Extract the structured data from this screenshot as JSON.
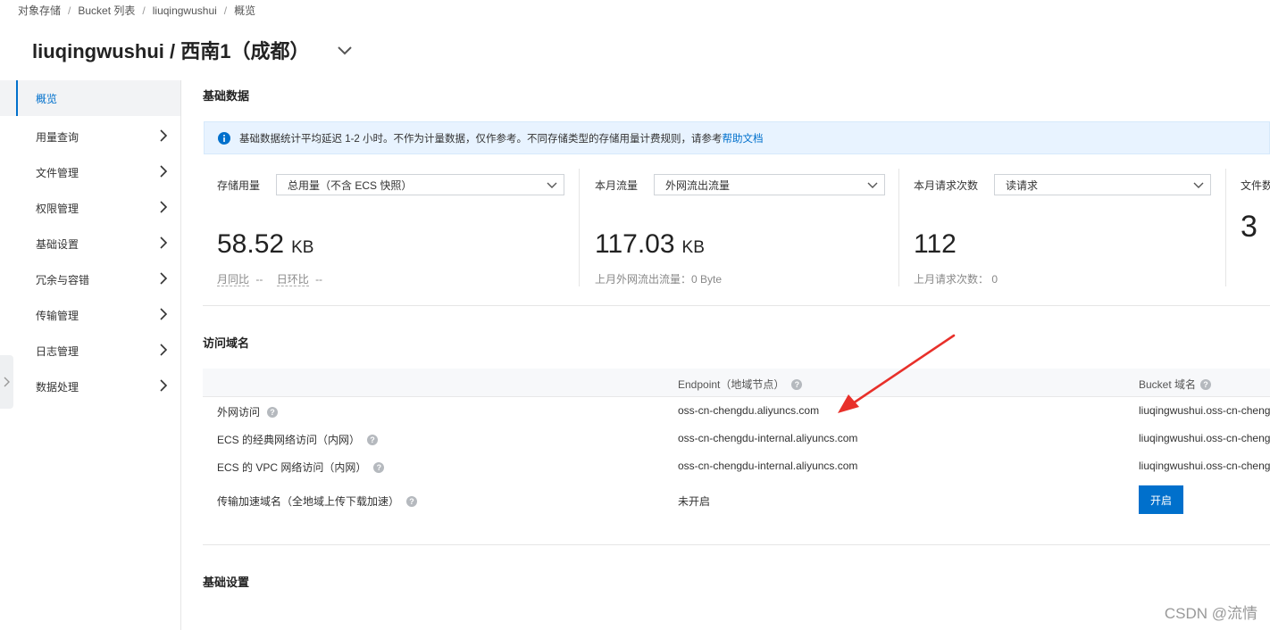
{
  "breadcrumb": [
    "对象存储",
    "Bucket 列表",
    "liuqingwushui",
    "概览"
  ],
  "page_title": "liuqingwushui / 西南1（成都）",
  "sidebar": {
    "items": [
      {
        "label": "概览",
        "active": true
      },
      {
        "label": "用量查询"
      },
      {
        "label": "文件管理"
      },
      {
        "label": "权限管理"
      },
      {
        "label": "基础设置"
      },
      {
        "label": "冗余与容错"
      },
      {
        "label": "传输管理"
      },
      {
        "label": "日志管理"
      },
      {
        "label": "数据处理"
      }
    ]
  },
  "sections": {
    "basic_data": "基础数据",
    "access_domain": "访问域名",
    "basic_settings": "基础设置"
  },
  "notice": {
    "text": "基础数据统计平均延迟 1-2 小时。不作为计量数据，仅作参考。不同存储类型的存储用量计费规则，请参考",
    "link": "帮助文档"
  },
  "stats": [
    {
      "label": "存储用量",
      "select": "总用量（不含 ECS 快照）",
      "value": "58.52",
      "unit": "KB",
      "sub_a_label": "月同比",
      "sub_a_value": "--",
      "sub_b_label": "日环比",
      "sub_b_value": "--"
    },
    {
      "label": "本月流量",
      "select": "外网流出流量",
      "value": "117.03",
      "unit": "KB",
      "sub": "上月外网流出流量：0 Byte"
    },
    {
      "label": "本月请求次数",
      "select": "读请求",
      "value": "112",
      "sub": "上月请求次数：  0"
    },
    {
      "label": "文件数",
      "value": "3"
    }
  ],
  "domain_table": {
    "headers": [
      "Endpoint（地域节点）",
      "Bucket 域名"
    ],
    "rows": [
      {
        "name": "外网访问",
        "endpoint": "oss-cn-chengdu.aliyuncs.com",
        "bucket": "liuqingwushui.oss-cn-chengdu.aliyuncs.com"
      },
      {
        "name": "ECS 的经典网络访问（内网）",
        "endpoint": "oss-cn-chengdu-internal.aliyuncs.com",
        "bucket": "liuqingwushui.oss-cn-chengdu-internal.aliyuncs.com"
      },
      {
        "name": "ECS 的 VPC 网络访问（内网）",
        "endpoint": "oss-cn-chengdu-internal.aliyuncs.com",
        "bucket": "liuqingwushui.oss-cn-chengdu-internal.aliyuncs.com"
      },
      {
        "name": "传输加速域名（全地域上传下载加速）",
        "endpoint": "未开启",
        "action": "开启"
      }
    ]
  },
  "watermark": "CSDN @流情",
  "colors": {
    "primary": "#0070cc",
    "notice_bg": "#e8f3ff",
    "annotation_arrow": "#e8302a"
  }
}
